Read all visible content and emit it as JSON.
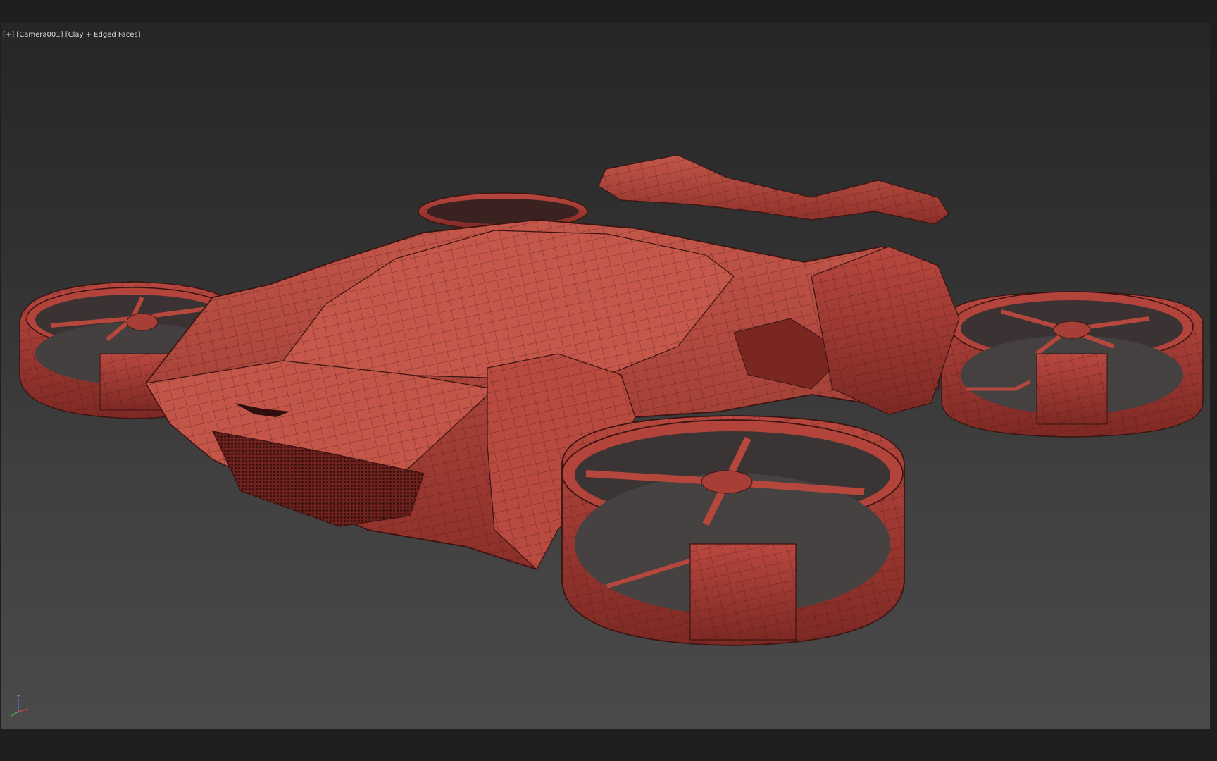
{
  "viewport": {
    "label_plus": "[+]",
    "label_camera": "[Camera001]",
    "label_shading": "[Clay + Edged Faces]"
  },
  "scene": {
    "object": "flying-car-drone-model",
    "material_color": "#b5473d",
    "wire_color": "#3a1411"
  },
  "axis_gizmo": {
    "z_label": "z"
  },
  "colors": {
    "background_top": "#262626",
    "background_bottom": "#4a4a4a",
    "frame": "#1f1f1f"
  }
}
